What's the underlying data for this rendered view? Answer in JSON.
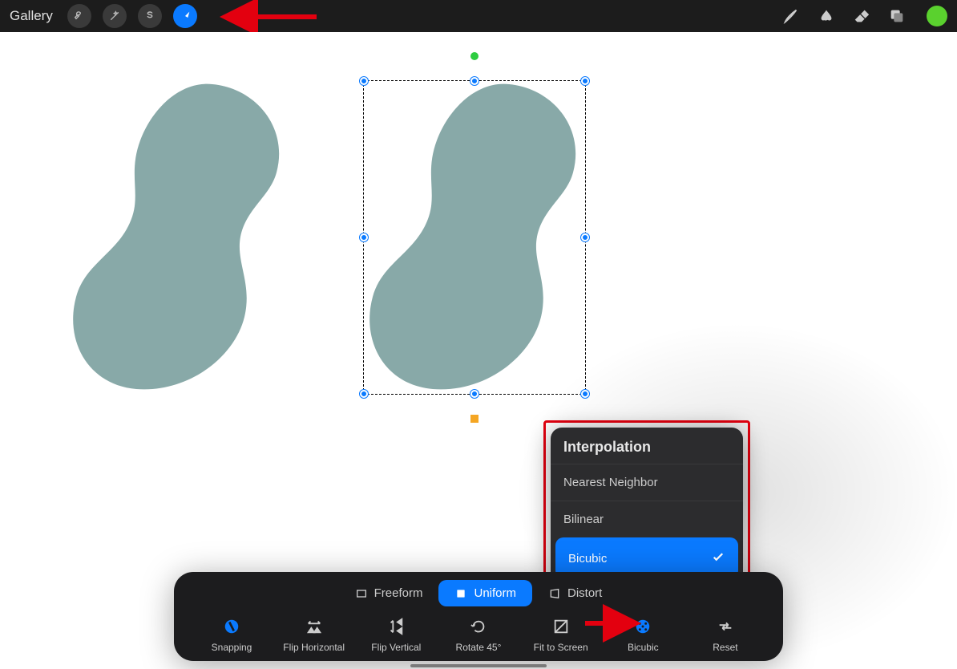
{
  "topbar": {
    "gallery_label": "Gallery",
    "color_swatch": "#5ad12e"
  },
  "popup": {
    "title": "Interpolation",
    "items": [
      {
        "label": "Nearest Neighbor",
        "selected": false
      },
      {
        "label": "Bilinear",
        "selected": false
      },
      {
        "label": "Bicubic",
        "selected": true
      }
    ]
  },
  "modes": {
    "freeform": "Freeform",
    "uniform": "Uniform",
    "distort": "Distort"
  },
  "actions": {
    "snapping": "Snapping",
    "flip_horizontal": "Flip Horizontal",
    "flip_vertical": "Flip Vertical",
    "rotate": "Rotate 45°",
    "fit": "Fit to Screen",
    "bicubic": "Bicubic",
    "reset": "Reset"
  }
}
